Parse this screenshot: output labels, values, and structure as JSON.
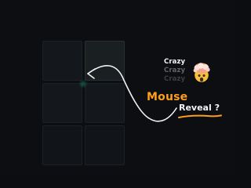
{
  "scene": {
    "tagline_lines": [
      "Crazy",
      "Crazy",
      "Crazy"
    ],
    "headline_primary": "Mouse",
    "headline_secondary": "Reveal ?",
    "emoji_icon": "exploding-head-emoji",
    "accent_color": "#ff9f1a",
    "teal_highlight": "#23b597",
    "background_color": "#0c0e11"
  }
}
